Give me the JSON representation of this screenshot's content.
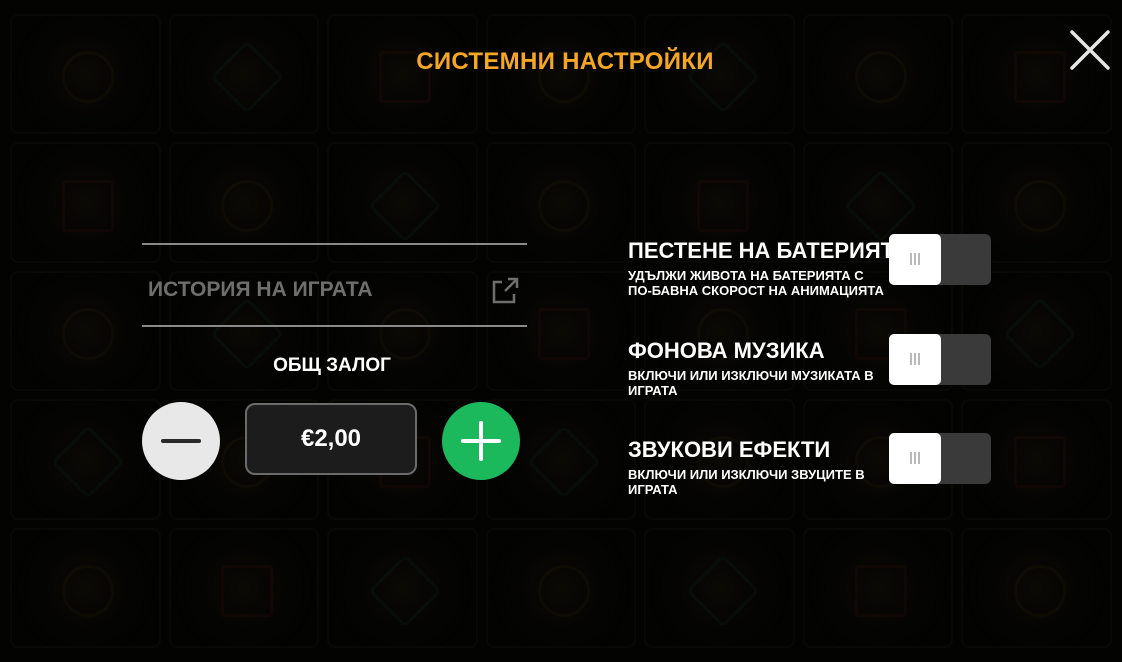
{
  "header": {
    "title": "СИСТЕМНИ НАСТРОЙКИ",
    "close_icon": "close-x-icon"
  },
  "left_panel": {
    "history_label": "ИСТОРИЯ НА ИГРАТА",
    "history_icon": "external-link-icon",
    "bet_title": "ОБЩ ЗАЛОГ",
    "bet_value": "€2,00",
    "minus_icon": "minus-icon",
    "plus_icon": "plus-icon"
  },
  "settings": [
    {
      "title": "ПЕСТЕНЕ НА БАТЕРИЯТА",
      "description": "УДЪЛЖИ ЖИВОТА НА БАТЕРИЯТА С ПО-БАВНА СКОРОСТ НА АНИМАЦИЯТА",
      "enabled": false
    },
    {
      "title": "ФОНОВА МУЗИКА",
      "description": "ВКЛЮЧИ ИЛИ ИЗКЛЮЧИ МУЗИКАТА В ИГРАТА",
      "enabled": false
    },
    {
      "title": "ЗВУКОВИ ЕФЕКТИ",
      "description": "ВКЛЮЧИ ИЛИ ИЗКЛЮЧИ ЗВУЦИТЕ В ИГРАТА",
      "enabled": false
    }
  ],
  "colors": {
    "title_accent": "#f5a623",
    "plus_button": "#1cb85c",
    "minus_button": "#e8e8e8",
    "toggle_track": "#3a3a3a"
  }
}
